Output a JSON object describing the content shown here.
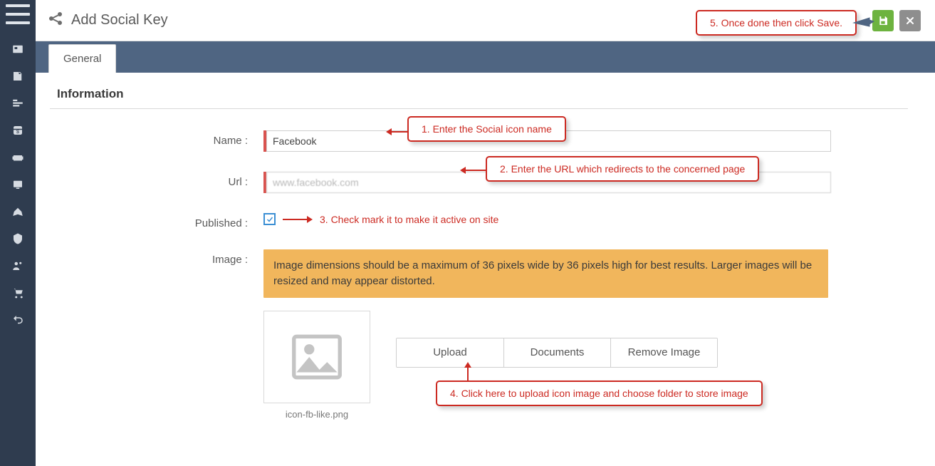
{
  "header": {
    "title": "Add Social Key"
  },
  "tabs": [
    {
      "label": "General"
    }
  ],
  "section": {
    "title": "Information"
  },
  "form": {
    "name_label": "Name :",
    "name_value": "Facebook",
    "url_label": "Url :",
    "url_value": "www.facebook.com",
    "published_label": "Published :",
    "published_hint": "3.  Check mark it to make it active on site",
    "image_label": "Image :",
    "image_note": "Image dimensions should be a maximum of 36 pixels wide by 36 pixels high for best results. Larger images will be resized and may appear distorted.",
    "image_filename": "icon-fb-like.png",
    "upload_label": "Upload",
    "documents_label": "Documents",
    "remove_label": "Remove Image"
  },
  "callouts": {
    "c1": "1. Enter the Social icon name",
    "c2": "2. Enter the URL which redirects to the concerned page",
    "c4": "4.  Click here to upload icon image and choose folder to store image",
    "c5": "5. Once done then click Save."
  }
}
